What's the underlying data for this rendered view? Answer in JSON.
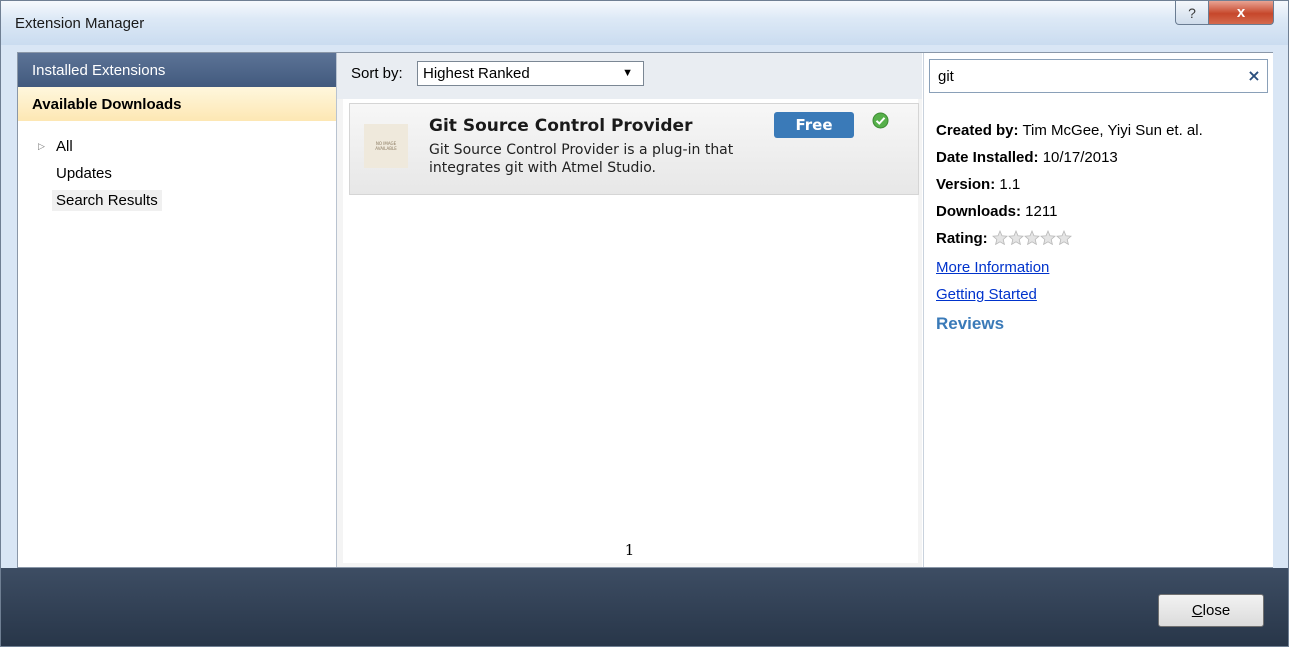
{
  "window": {
    "title": "Extension Manager",
    "help_glyph": "?",
    "close_glyph": "x"
  },
  "sidebar": {
    "installed_tab": "Installed Extensions",
    "available_tab": "Available Downloads",
    "tree": [
      {
        "label": "All",
        "expandable": true
      },
      {
        "label": "Updates",
        "expandable": false
      },
      {
        "label": "Search Results",
        "expandable": false,
        "selected": true
      }
    ]
  },
  "sortbar": {
    "label": "Sort by:",
    "selected": "Highest Ranked"
  },
  "results": [
    {
      "title": "Git Source Control Provider",
      "description": "Git Source Control Provider is a plug-in that integrates git with Atmel Studio.",
      "badge": "Free",
      "installed": true
    }
  ],
  "pager": {
    "current": "1"
  },
  "search": {
    "value": "git",
    "clear_glyph": "×"
  },
  "details": {
    "created_by_label": "Created by:",
    "created_by": "Tim McGee, Yiyi Sun et. al.",
    "date_label": "Date Installed:",
    "date": "10/17/2013",
    "version_label": "Version:",
    "version": "1.1",
    "downloads_label": "Downloads:",
    "downloads": "1211",
    "rating_label": "Rating:",
    "rating": 0,
    "rating_max": 5,
    "more_info": "More Information",
    "getting_started": "Getting Started",
    "reviews": "Reviews"
  },
  "footer": {
    "close_label_underlined": "C",
    "close_label_rest": "lose"
  },
  "colors": {
    "accent": "#3a7ab8",
    "installed_check": "#4caf50",
    "footer": "#2f3d52"
  }
}
